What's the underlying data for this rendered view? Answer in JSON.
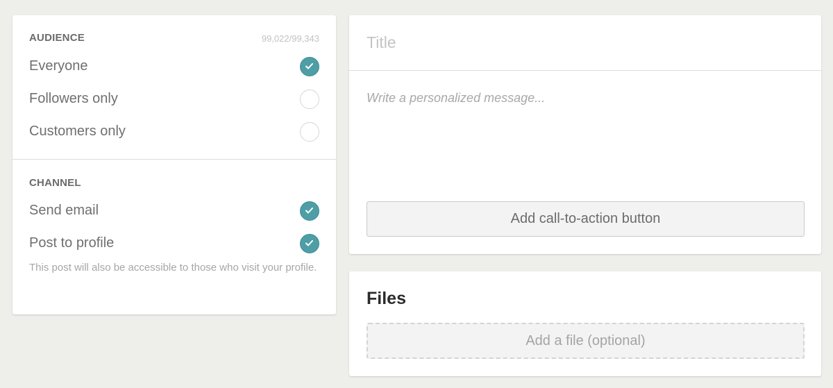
{
  "audience": {
    "heading": "AUDIENCE",
    "count": "99,022/99,343",
    "options": [
      {
        "label": "Everyone",
        "selected": true
      },
      {
        "label": "Followers only",
        "selected": false
      },
      {
        "label": "Customers only",
        "selected": false
      }
    ]
  },
  "channel": {
    "heading": "CHANNEL",
    "options": [
      {
        "label": "Send email",
        "selected": true
      },
      {
        "label": "Post to profile",
        "selected": true
      }
    ],
    "help_text": "This post will also be accessible to those who visit your profile."
  },
  "message": {
    "title_placeholder": "Title",
    "title_value": "",
    "body_placeholder": "Write a personalized message...",
    "body_value": "",
    "cta_label": "Add call-to-action button"
  },
  "files": {
    "heading": "Files",
    "add_label": "Add a file (optional)"
  },
  "colors": {
    "accent": "#4f9ea6",
    "background": "#eeeeea",
    "card": "#ffffff"
  },
  "icons": {
    "selected": "checkmark-icon"
  }
}
